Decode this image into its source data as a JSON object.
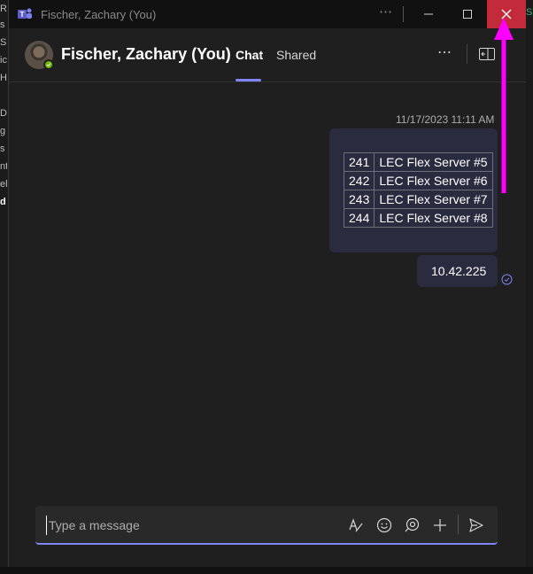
{
  "window": {
    "title": "Fischer, Zachary (You)",
    "more_label": "⋯"
  },
  "header": {
    "contact_name": "Fischer, Zachary (You)",
    "tabs": [
      {
        "label": "Chat",
        "active": true
      },
      {
        "label": "Shared",
        "active": false
      }
    ],
    "more_label": "⋯"
  },
  "messages": {
    "timestamp": "11/17/2023 11:11 AM",
    "table_rows": [
      [
        "241",
        "LEC Flex Server #5"
      ],
      [
        "242",
        "LEC Flex Server #6"
      ],
      [
        "243",
        "LEC Flex Server #7"
      ],
      [
        "244",
        "LEC Flex Server #8"
      ]
    ],
    "ip_message": "10.42.225"
  },
  "composer": {
    "placeholder": "Type a message"
  },
  "colors": {
    "accent": "#7f85f5",
    "close_red": "#c42b3a",
    "annotation_arrow": "#ff00ff",
    "bubble": "#2b2b40",
    "presence_green": "#6bb700"
  },
  "icons": [
    "teams-icon",
    "minimize-icon",
    "maximize-icon",
    "close-icon",
    "popout-icon",
    "format-icon",
    "emoji-icon",
    "loop-icon",
    "add-icon",
    "send-icon",
    "read-receipt-icon"
  ]
}
